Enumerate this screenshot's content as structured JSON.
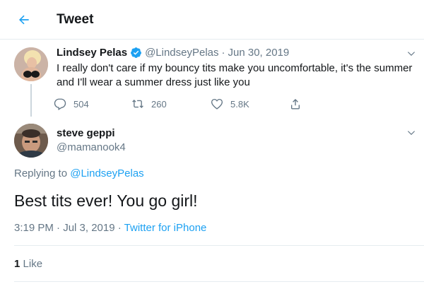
{
  "header": {
    "title": "Tweet",
    "back_icon": "arrow-left-icon"
  },
  "colors": {
    "accent": "#1da1f2",
    "text": "#14171a",
    "muted": "#657786",
    "border": "#e6ecf0"
  },
  "parent_tweet": {
    "name": "Lindsey Pelas",
    "verified": true,
    "handle": "@LindseyPelas",
    "date": "Jun 30, 2019",
    "separator": "·",
    "text": "I really don't care if my bouncy tits make you uncomfortable, it's the summer and I'll wear a summer dress just like you",
    "actions": [
      {
        "icon": "reply-icon",
        "count": "504"
      },
      {
        "icon": "retweet-icon",
        "count": "260"
      },
      {
        "icon": "heart-icon",
        "count": "5.8K"
      },
      {
        "icon": "share-icon",
        "count": ""
      }
    ]
  },
  "tweet": {
    "name": "steve geppi",
    "handle": "@mamanook4",
    "replying_prefix": "Replying to",
    "replying_to": "@LindseyPelas",
    "text": "Best tits ever! You go girl!",
    "timestamp": "3:19 PM · Jul 3, 2019 ·",
    "source": "Twitter for iPhone",
    "likes_count": "1",
    "likes_label": "Like"
  }
}
